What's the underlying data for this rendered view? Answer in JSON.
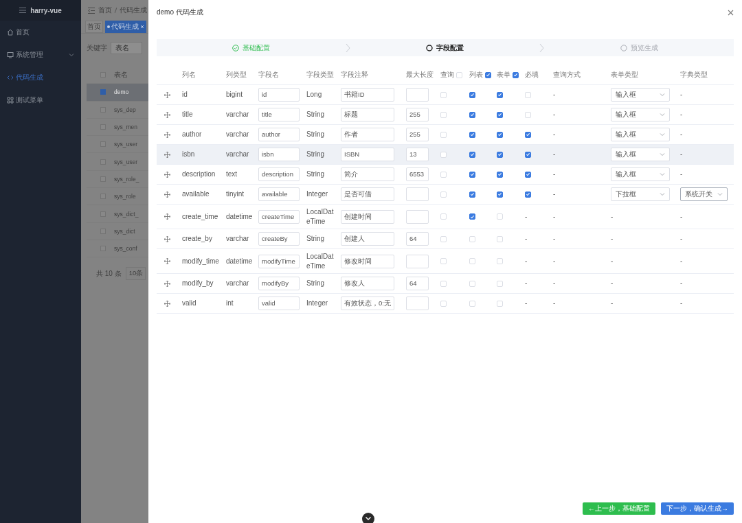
{
  "sidebar": {
    "title": "harry-vue",
    "items": [
      {
        "label": "首页",
        "expandable": false,
        "selected": false
      },
      {
        "label": "系统管理",
        "expandable": true,
        "selected": false
      },
      {
        "label": "代码生成",
        "expandable": false,
        "selected": true
      },
      {
        "label": "测试菜单",
        "expandable": false,
        "selected": false
      }
    ]
  },
  "navbar": {
    "breadcrumb": [
      "首页",
      "代码生成"
    ]
  },
  "tags": [
    {
      "label": "首页",
      "selected": false
    },
    {
      "label": "代码生成",
      "selected": true
    }
  ],
  "search": {
    "label": "关键字",
    "placeholder": "表名"
  },
  "table_list": {
    "column": "表名",
    "all_checked": false,
    "rows": [
      {
        "name": "demo",
        "selected": true
      },
      {
        "name": "sys_dep",
        "selected": false
      },
      {
        "name": "sys_men",
        "selected": false
      },
      {
        "name": "sys_user",
        "selected": false
      },
      {
        "name": "sys_user",
        "selected": false
      },
      {
        "name": "sys_role_",
        "selected": false
      },
      {
        "name": "sys_role",
        "selected": false
      },
      {
        "name": "sys_dict_",
        "selected": false
      },
      {
        "name": "sys_dict",
        "selected": false
      },
      {
        "name": "sys_conf",
        "selected": false
      }
    ]
  },
  "pagination": {
    "total": "共 10 条",
    "page_size": "10条"
  },
  "dialog": {
    "title": "demo 代码生成",
    "steps": [
      {
        "label": "基础配置",
        "done": true,
        "selected": false
      },
      {
        "label": "字段配置",
        "done": false,
        "selected": true
      },
      {
        "label": "预览生成",
        "done": false,
        "selected": false
      }
    ],
    "columns": [
      {
        "label": "列名"
      },
      {
        "label": "列类型"
      },
      {
        "label": "字段名"
      },
      {
        "label": "字段类型"
      },
      {
        "label": "字段注释"
      },
      {
        "label": "最大长度"
      },
      {
        "label": "查询",
        "checked": false
      },
      {
        "label": "列表",
        "checked": true
      },
      {
        "label": "表单",
        "checked": true
      },
      {
        "label": "必填"
      },
      {
        "label": "查询方式"
      },
      {
        "label": "表单类型"
      },
      {
        "label": "字典类型"
      }
    ],
    "rows": [
      {
        "column": "id",
        "column_type": "bigint",
        "field": "id",
        "java_type": "Long",
        "comment": "书籍ID",
        "query": false,
        "list": true,
        "form": true,
        "required": {
          "kind": "checkbox",
          "checked": false
        },
        "query_mode": "-",
        "form_type": {
          "kind": "select",
          "value": "输入框"
        },
        "dict_type": {
          "kind": "text",
          "value": "-"
        },
        "hovered": false
      },
      {
        "column": "title",
        "column_type": "varchar",
        "field": "title",
        "java_type": "String",
        "comment": "标题",
        "max_length": "255",
        "query": false,
        "list": true,
        "form": true,
        "required": {
          "kind": "checkbox",
          "checked": false
        },
        "query_mode": "-",
        "form_type": {
          "kind": "select",
          "value": "输入框"
        },
        "dict_type": {
          "kind": "text",
          "value": "-"
        },
        "hovered": false
      },
      {
        "column": "author",
        "column_type": "varchar",
        "field": "author",
        "java_type": "String",
        "comment": "作者",
        "max_length": "255",
        "query": false,
        "list": true,
        "form": true,
        "required": {
          "kind": "checkbox",
          "checked": true
        },
        "query_mode": "-",
        "form_type": {
          "kind": "select",
          "value": "输入框"
        },
        "dict_type": {
          "kind": "text",
          "value": "-"
        },
        "hovered": false
      },
      {
        "column": "isbn",
        "column_type": "varchar",
        "field": "isbn",
        "java_type": "String",
        "comment": "ISBN",
        "max_length": "13",
        "query": false,
        "list": true,
        "form": true,
        "required": {
          "kind": "checkbox",
          "checked": true
        },
        "query_mode": "-",
        "form_type": {
          "kind": "select",
          "value": "输入框"
        },
        "dict_type": {
          "kind": "text",
          "value": "-"
        },
        "hovered": true
      },
      {
        "column": "description",
        "column_type": "text",
        "field": "description",
        "java_type": "String",
        "comment": "简介",
        "max_length": "6553",
        "query": false,
        "list": true,
        "form": true,
        "required": {
          "kind": "checkbox",
          "checked": true
        },
        "query_mode": "-",
        "form_type": {
          "kind": "select",
          "value": "输入框"
        },
        "dict_type": {
          "kind": "text",
          "value": "-"
        },
        "hovered": false
      },
      {
        "column": "available",
        "column_type": "tinyint",
        "field": "available",
        "java_type": "Integer",
        "comment": "是否可借",
        "query": false,
        "list": true,
        "form": true,
        "required": {
          "kind": "checkbox",
          "checked": true
        },
        "query_mode": "-",
        "form_type": {
          "kind": "select",
          "value": "下拉框"
        },
        "dict_type": {
          "kind": "select",
          "value": "系统开关"
        },
        "hovered": false
      },
      {
        "column": "create_time",
        "column_type": "datetime",
        "field": "createTime",
        "java_type": "LocalDateTime",
        "comment": "创建时间",
        "query": false,
        "list": true,
        "form": false,
        "required": {
          "kind": "text",
          "value": "-"
        },
        "query_mode": "-",
        "form_type": {
          "kind": "text",
          "value": "-"
        },
        "dict_type": {
          "kind": "text",
          "value": "-"
        },
        "hovered": false
      },
      {
        "column": "create_by",
        "column_type": "varchar",
        "field": "createBy",
        "java_type": "String",
        "comment": "创建人",
        "max_length": "64",
        "query": false,
        "list": false,
        "form": false,
        "required": {
          "kind": "text",
          "value": "-"
        },
        "query_mode": "-",
        "form_type": {
          "kind": "text",
          "value": "-"
        },
        "dict_type": {
          "kind": "text",
          "value": "-"
        },
        "hovered": false
      },
      {
        "column": "modify_time",
        "column_type": "datetime",
        "field": "modifyTime",
        "java_type": "LocalDateTime",
        "comment": "修改时间",
        "query": false,
        "list": false,
        "form": false,
        "required": {
          "kind": "text",
          "value": "-"
        },
        "query_mode": "-",
        "form_type": {
          "kind": "text",
          "value": "-"
        },
        "dict_type": {
          "kind": "text",
          "value": "-"
        },
        "hovered": false
      },
      {
        "column": "modify_by",
        "column_type": "varchar",
        "field": "modifyBy",
        "java_type": "String",
        "comment": "修改人",
        "max_length": "64",
        "query": false,
        "list": false,
        "form": false,
        "required": {
          "kind": "text",
          "value": "-"
        },
        "query_mode": "-",
        "form_type": {
          "kind": "text",
          "value": "-"
        },
        "dict_type": {
          "kind": "text",
          "value": "-"
        },
        "hovered": false
      },
      {
        "column": "valid",
        "column_type": "int",
        "field": "valid",
        "java_type": "Integer",
        "comment": "有效状态，0:无",
        "query": false,
        "list": false,
        "form": false,
        "required": {
          "kind": "text",
          "value": "-"
        },
        "query_mode": "-",
        "form_type": {
          "kind": "text",
          "value": "-"
        },
        "dict_type": {
          "kind": "text",
          "value": "-"
        },
        "hovered": false
      }
    ],
    "buttons": [
      {
        "label": "←上一步，基础配置",
        "kind": "prev"
      },
      {
        "label": "下一步，确认生成→",
        "kind": "next"
      }
    ]
  }
}
